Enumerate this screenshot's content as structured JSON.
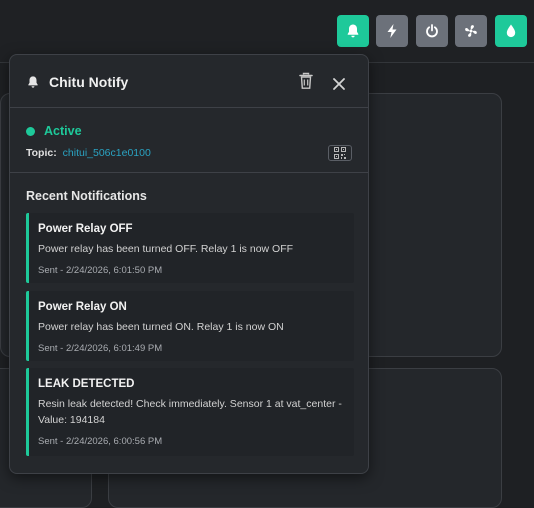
{
  "toolbar": {
    "buttons": [
      {
        "name": "bell",
        "color": "#1ec99a"
      },
      {
        "name": "bolt",
        "color": "#6c717a"
      },
      {
        "name": "power",
        "color": "#6c717a"
      },
      {
        "name": "fan",
        "color": "#6c717a"
      },
      {
        "name": "droplet",
        "color": "#1ec99a"
      }
    ]
  },
  "panel": {
    "title": "Chitu Notify",
    "status": "Active",
    "topic_label": "Topic:",
    "topic_value": "chitui_506c1e0100",
    "recent_heading": "Recent Notifications",
    "notifications": [
      {
        "title": "Power Relay OFF",
        "message": "Power relay has been turned OFF. Relay 1 is now OFF",
        "time": "Sent - 2/24/2026, 6:01:50 PM"
      },
      {
        "title": "Power Relay ON",
        "message": "Power relay has been turned ON. Relay 1 is now ON",
        "time": "Sent - 2/24/2026, 6:01:49 PM"
      },
      {
        "title": "LEAK DETECTED",
        "message": "Resin leak detected! Check immediately. Sensor 1 at vat_center - Value: 194184",
        "time": "Sent - 2/24/2026, 6:00:56 PM"
      }
    ]
  },
  "colors": {
    "accent": "#1ec99a",
    "link": "#2aa3c2",
    "panel_bg": "#25282c"
  }
}
